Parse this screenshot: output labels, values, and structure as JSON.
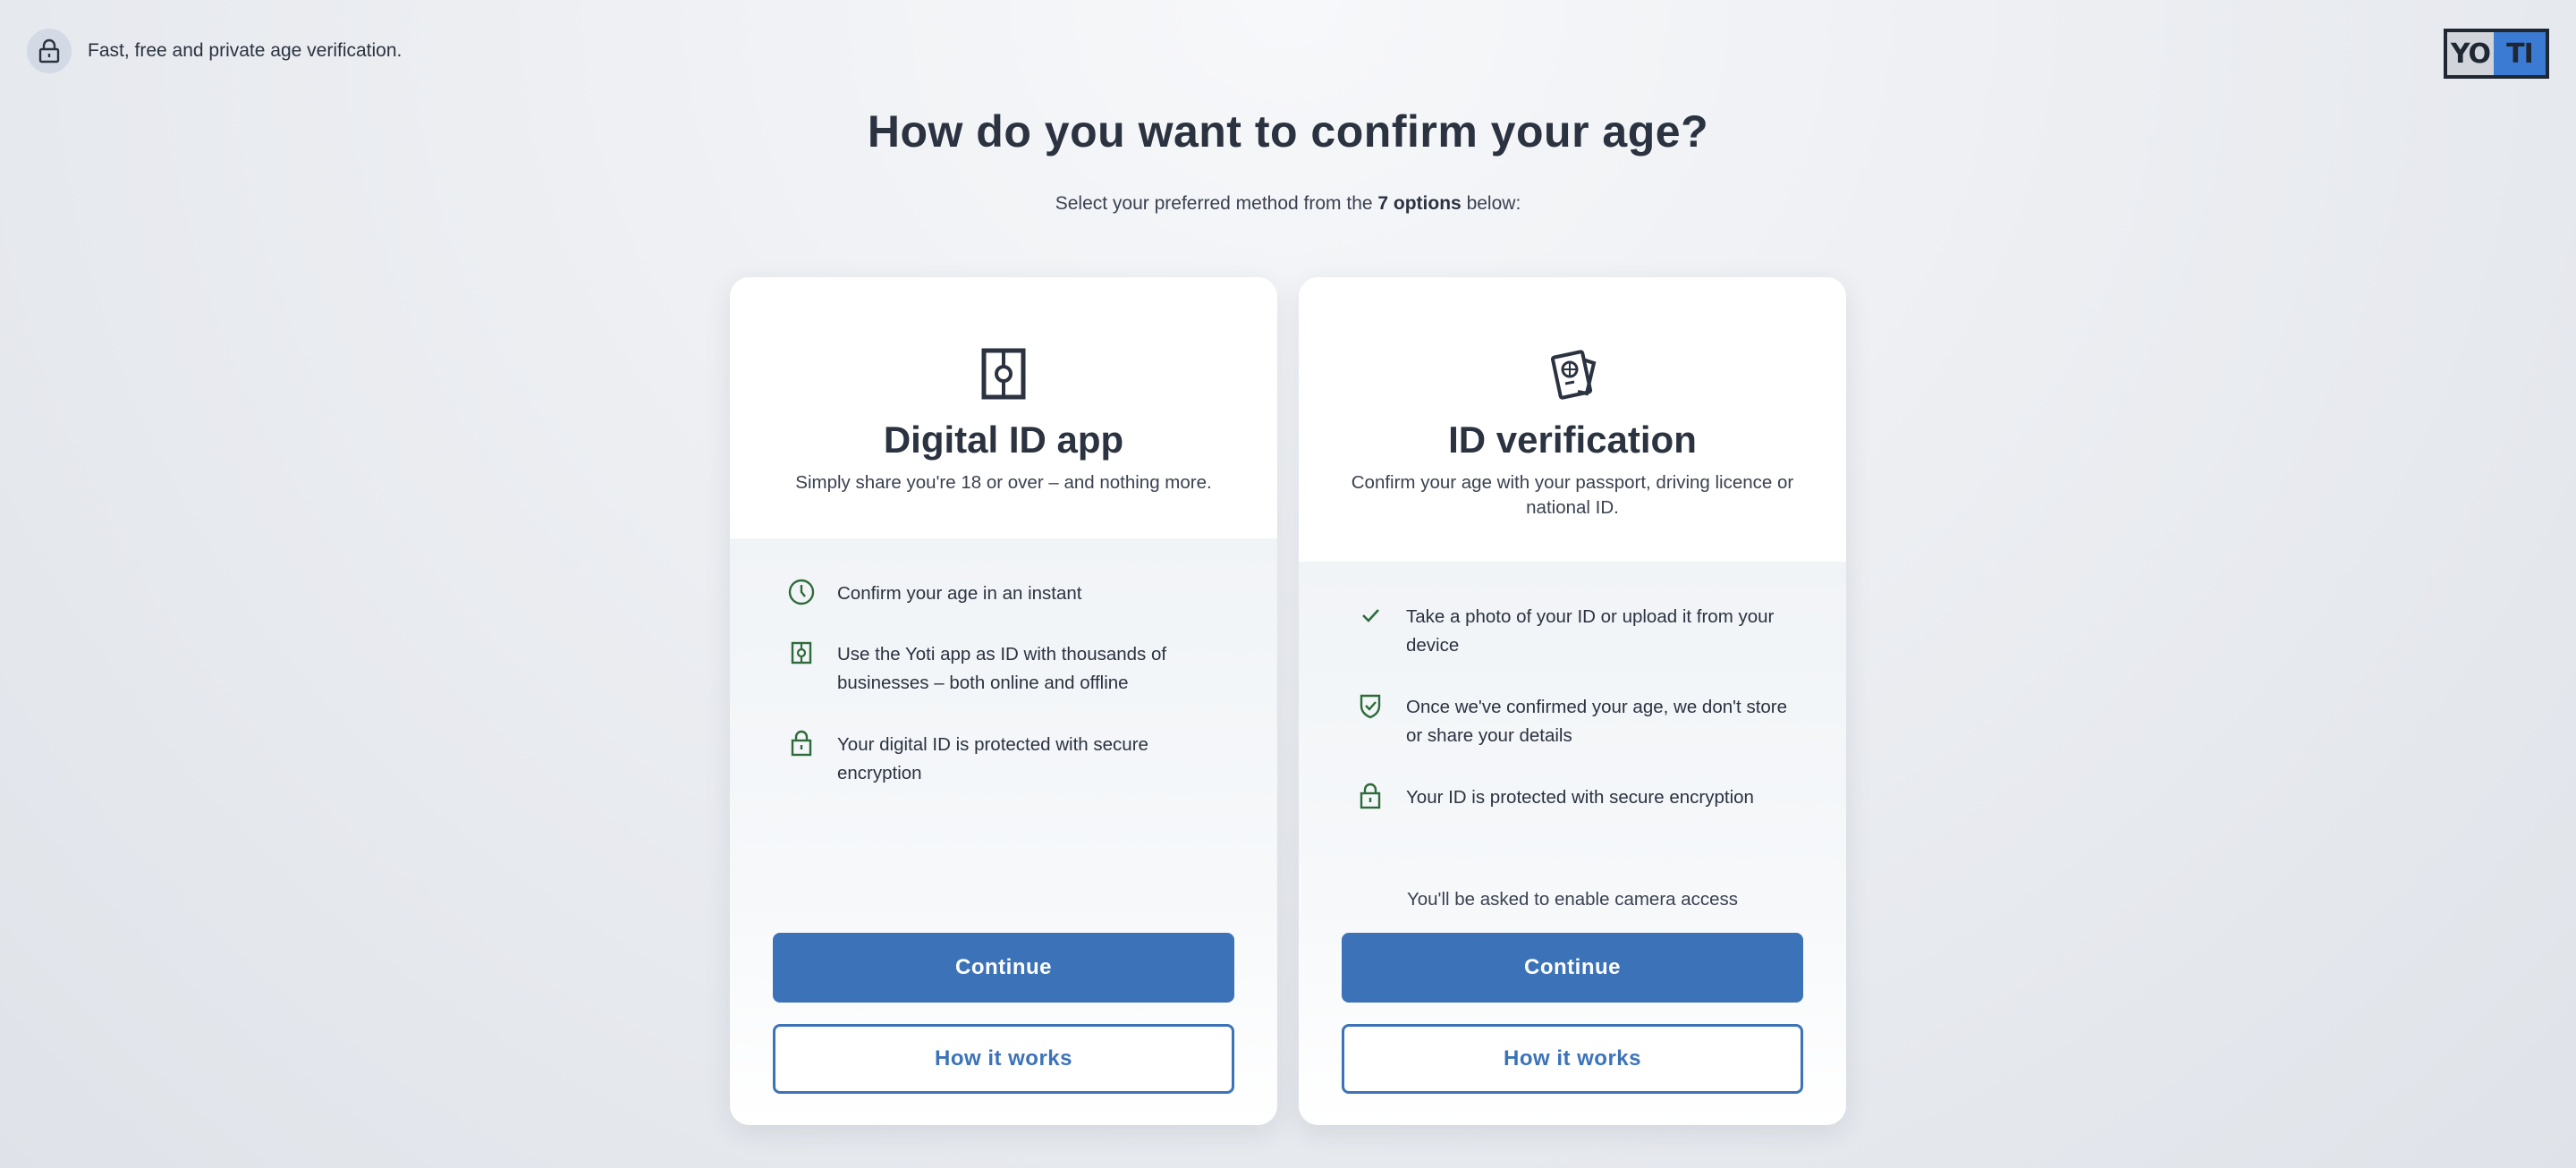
{
  "header": {
    "tagline": "Fast, free and private age verification.",
    "logo_text_left": "YO",
    "logo_text_right": "TI"
  },
  "page": {
    "title": "How do you want to confirm your age?",
    "subtitle_prefix": "Select your preferred method from the ",
    "subtitle_bold": "7 options",
    "subtitle_suffix": " below:"
  },
  "cards": [
    {
      "icon": "digital-id-icon",
      "title": "Digital ID app",
      "description": "Simply share you're 18 or over – and nothing more.",
      "features": [
        {
          "icon": "clock-icon",
          "text": "Confirm your age in an instant"
        },
        {
          "icon": "yoti-app-icon",
          "text": "Use the Yoti app as ID with thousands of businesses – both online and offline"
        },
        {
          "icon": "lock-icon",
          "text": "Your digital ID is protected with secure encryption"
        }
      ],
      "note": "",
      "continue_label": "Continue",
      "how_label": "How it works"
    },
    {
      "icon": "passport-icon",
      "title": "ID verification",
      "description": "Confirm your age with your passport, driving licence or national ID.",
      "features": [
        {
          "icon": "check-icon",
          "text": "Take a photo of your ID or upload it from your device"
        },
        {
          "icon": "shield-check-icon",
          "text": "Once we've confirmed your age, we don't store or share your details"
        },
        {
          "icon": "lock-icon",
          "text": "Your ID is protected with secure encryption"
        }
      ],
      "note": "You'll be asked to enable camera access",
      "continue_label": "Continue",
      "how_label": "How it works"
    }
  ],
  "colors": {
    "primary": "#3c73b8",
    "heading": "#2b3240",
    "feature_icon": "#2e6b3a",
    "logo_blue": "#3b7bd4"
  }
}
